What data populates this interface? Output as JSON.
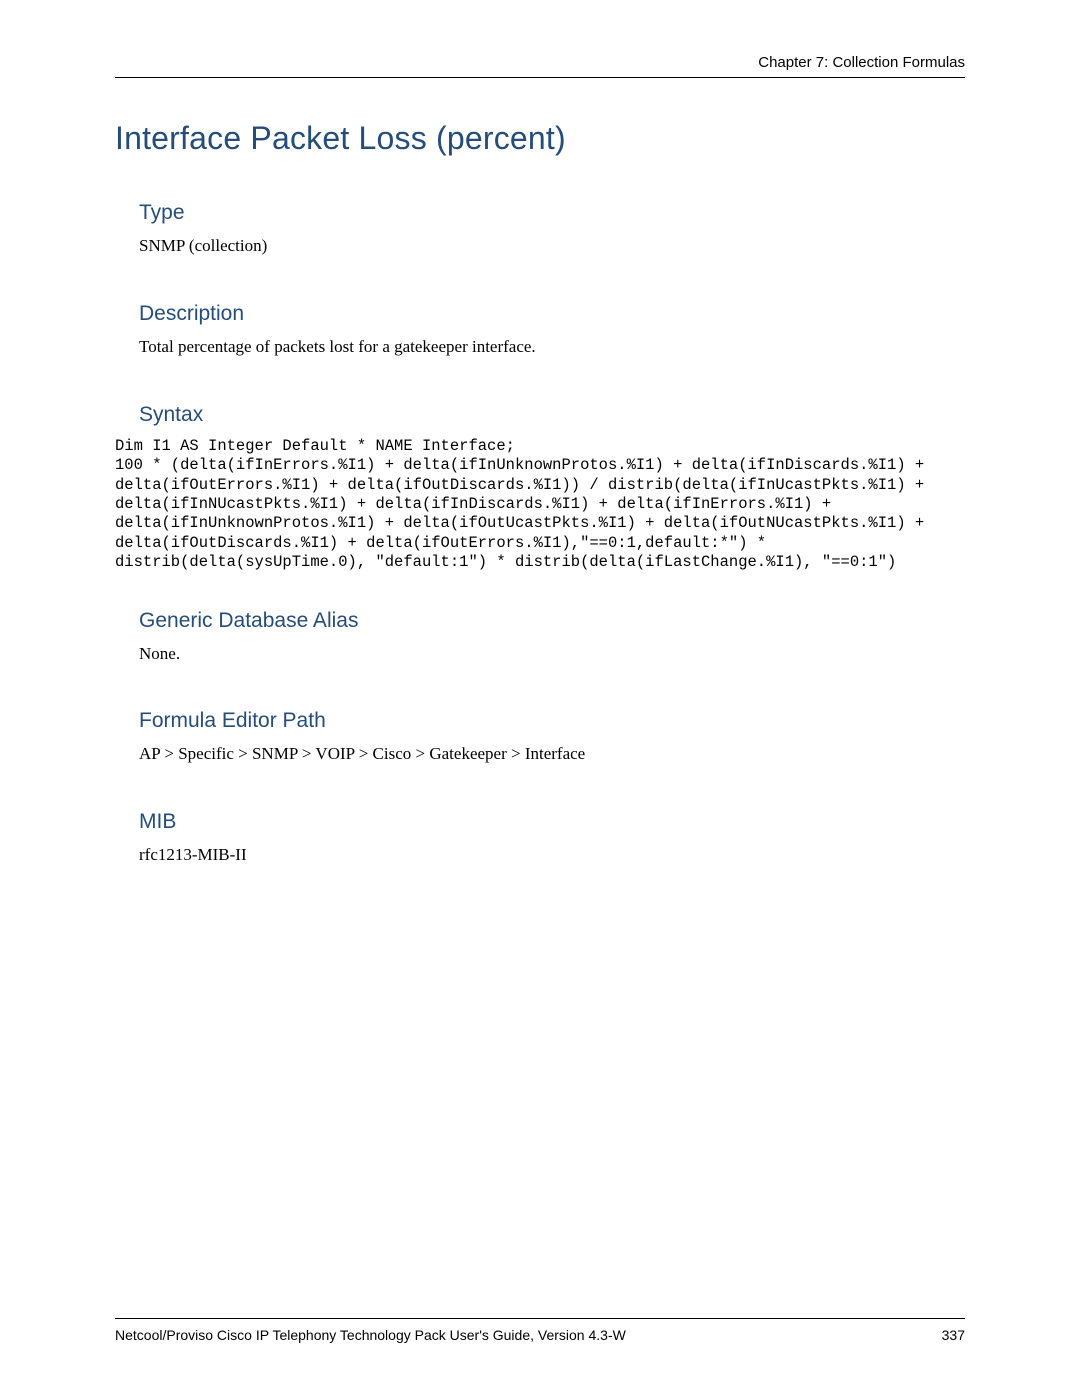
{
  "header": {
    "chapter": "Chapter 7: Collection Formulas"
  },
  "title": "Interface Packet Loss (percent)",
  "sections": {
    "type": {
      "heading": "Type",
      "body": "SNMP (collection)"
    },
    "description": {
      "heading": "Description",
      "body": "Total percentage of packets lost for a gatekeeper interface."
    },
    "syntax": {
      "heading": "Syntax",
      "code": "Dim I1 AS Integer Default * NAME Interface;\n100 * (delta(ifInErrors.%I1) + delta(ifInUnknownProtos.%I1) + delta(ifInDiscards.%I1) + delta(ifOutErrors.%I1) + delta(ifOutDiscards.%I1)) / distrib(delta(ifInUcastPkts.%I1) + delta(ifInNUcastPkts.%I1) + delta(ifInDiscards.%I1) + delta(ifInErrors.%I1) + delta(ifInUnknownProtos.%I1) + delta(ifOutUcastPkts.%I1) + delta(ifOutNUcastPkts.%I1) + delta(ifOutDiscards.%I1) + delta(ifOutErrors.%I1),\"==0:1,default:*\") * distrib(delta(sysUpTime.0), \"default:1\") * distrib(delta(ifLastChange.%I1), \"==0:1\")"
    },
    "alias": {
      "heading": "Generic Database Alias",
      "body": "None."
    },
    "path": {
      "heading": "Formula Editor Path",
      "body": "AP > Specific > SNMP > VOIP > Cisco > Gatekeeper > Interface"
    },
    "mib": {
      "heading": "MIB",
      "body": "rfc1213-MIB-II"
    }
  },
  "footer": {
    "guide": "Netcool/Proviso Cisco IP Telephony Technology Pack User's Guide, Version 4.3-W",
    "page": "337"
  }
}
